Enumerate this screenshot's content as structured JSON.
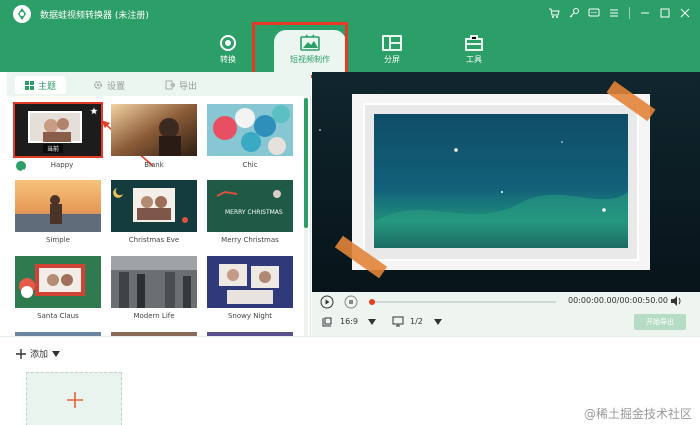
{
  "window": {
    "title": "数据蛙视频转换器 (未注册)"
  },
  "nav": {
    "tabs": [
      {
        "label": "转换",
        "icon": "convert-icon"
      },
      {
        "label": "短视频制作",
        "icon": "image-icon"
      },
      {
        "label": "分屏",
        "icon": "split-screen-icon"
      },
      {
        "label": "工具",
        "icon": "toolbox-icon"
      }
    ],
    "active": "短视频制作"
  },
  "subtabs": {
    "theme": "主题",
    "settings": "设置",
    "export": "导出"
  },
  "templates": [
    {
      "label": "Happy",
      "badge": "当前"
    },
    {
      "label": "Blank"
    },
    {
      "label": "Chic"
    },
    {
      "label": "Simple"
    },
    {
      "label": "Christmas Eve"
    },
    {
      "label": "Merry Christmas"
    },
    {
      "label": "Santa Claus"
    },
    {
      "label": "Modern Life"
    },
    {
      "label": "Snowy Night"
    }
  ],
  "templates_text": {
    "merry_title": "MERRY CHRISTMAS"
  },
  "player": {
    "time": "00:00:00.00/00:00:50.00",
    "aspect_ratio": "16:9",
    "split": "1/2",
    "export_button": "开始导出",
    "progress": 0
  },
  "bottom": {
    "add_label": "添加"
  },
  "watermark": "@稀土掘金技术社区",
  "colors": {
    "brand_green": "#2c9e67",
    "highlight_red": "#e53a25",
    "tape_orange": "#e2843a"
  }
}
